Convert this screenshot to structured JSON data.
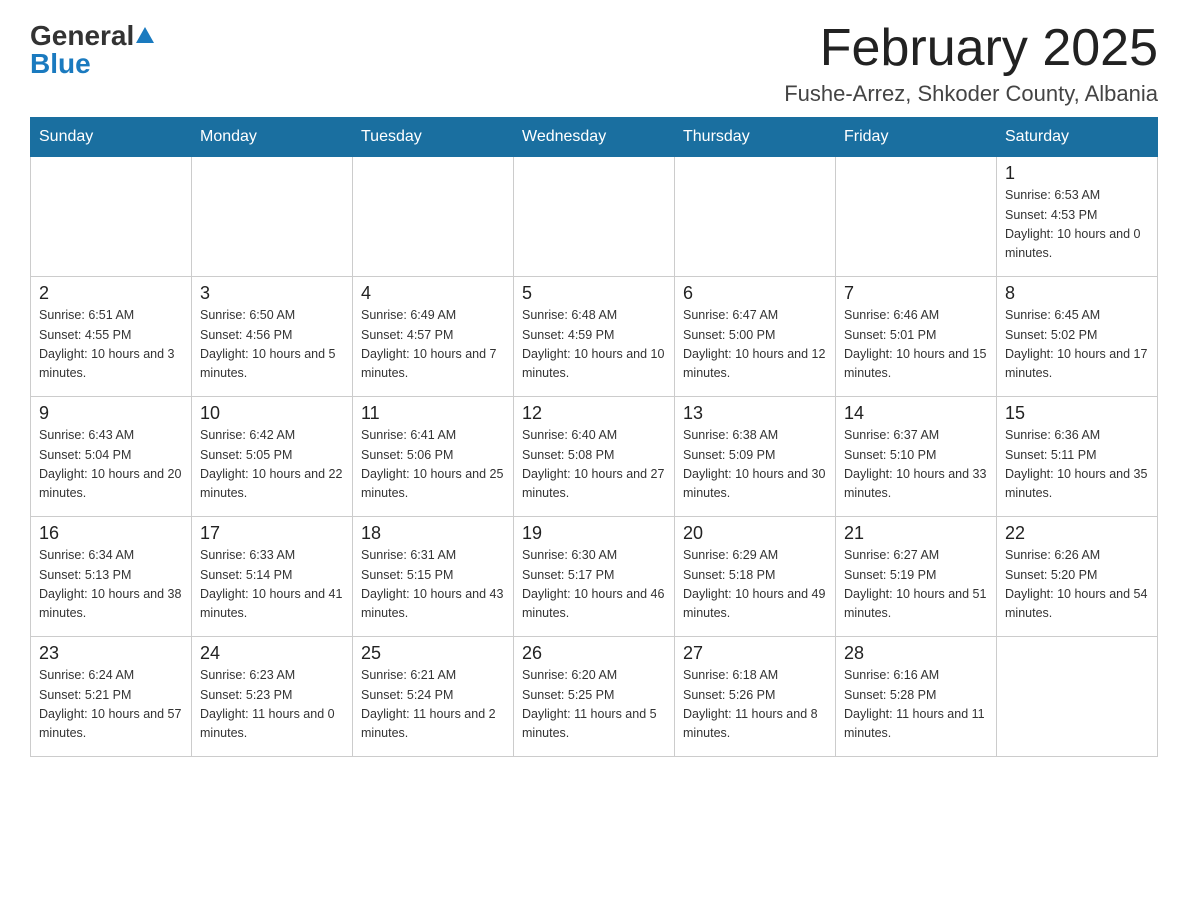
{
  "header": {
    "logo_general": "General",
    "logo_blue": "Blue",
    "month_title": "February 2025",
    "location": "Fushe-Arrez, Shkoder County, Albania"
  },
  "days_of_week": [
    "Sunday",
    "Monday",
    "Tuesday",
    "Wednesday",
    "Thursday",
    "Friday",
    "Saturday"
  ],
  "weeks": [
    [
      {
        "day": "",
        "info": ""
      },
      {
        "day": "",
        "info": ""
      },
      {
        "day": "",
        "info": ""
      },
      {
        "day": "",
        "info": ""
      },
      {
        "day": "",
        "info": ""
      },
      {
        "day": "",
        "info": ""
      },
      {
        "day": "1",
        "info": "Sunrise: 6:53 AM\nSunset: 4:53 PM\nDaylight: 10 hours and 0 minutes."
      }
    ],
    [
      {
        "day": "2",
        "info": "Sunrise: 6:51 AM\nSunset: 4:55 PM\nDaylight: 10 hours and 3 minutes."
      },
      {
        "day": "3",
        "info": "Sunrise: 6:50 AM\nSunset: 4:56 PM\nDaylight: 10 hours and 5 minutes."
      },
      {
        "day": "4",
        "info": "Sunrise: 6:49 AM\nSunset: 4:57 PM\nDaylight: 10 hours and 7 minutes."
      },
      {
        "day": "5",
        "info": "Sunrise: 6:48 AM\nSunset: 4:59 PM\nDaylight: 10 hours and 10 minutes."
      },
      {
        "day": "6",
        "info": "Sunrise: 6:47 AM\nSunset: 5:00 PM\nDaylight: 10 hours and 12 minutes."
      },
      {
        "day": "7",
        "info": "Sunrise: 6:46 AM\nSunset: 5:01 PM\nDaylight: 10 hours and 15 minutes."
      },
      {
        "day": "8",
        "info": "Sunrise: 6:45 AM\nSunset: 5:02 PM\nDaylight: 10 hours and 17 minutes."
      }
    ],
    [
      {
        "day": "9",
        "info": "Sunrise: 6:43 AM\nSunset: 5:04 PM\nDaylight: 10 hours and 20 minutes."
      },
      {
        "day": "10",
        "info": "Sunrise: 6:42 AM\nSunset: 5:05 PM\nDaylight: 10 hours and 22 minutes."
      },
      {
        "day": "11",
        "info": "Sunrise: 6:41 AM\nSunset: 5:06 PM\nDaylight: 10 hours and 25 minutes."
      },
      {
        "day": "12",
        "info": "Sunrise: 6:40 AM\nSunset: 5:08 PM\nDaylight: 10 hours and 27 minutes."
      },
      {
        "day": "13",
        "info": "Sunrise: 6:38 AM\nSunset: 5:09 PM\nDaylight: 10 hours and 30 minutes."
      },
      {
        "day": "14",
        "info": "Sunrise: 6:37 AM\nSunset: 5:10 PM\nDaylight: 10 hours and 33 minutes."
      },
      {
        "day": "15",
        "info": "Sunrise: 6:36 AM\nSunset: 5:11 PM\nDaylight: 10 hours and 35 minutes."
      }
    ],
    [
      {
        "day": "16",
        "info": "Sunrise: 6:34 AM\nSunset: 5:13 PM\nDaylight: 10 hours and 38 minutes."
      },
      {
        "day": "17",
        "info": "Sunrise: 6:33 AM\nSunset: 5:14 PM\nDaylight: 10 hours and 41 minutes."
      },
      {
        "day": "18",
        "info": "Sunrise: 6:31 AM\nSunset: 5:15 PM\nDaylight: 10 hours and 43 minutes."
      },
      {
        "day": "19",
        "info": "Sunrise: 6:30 AM\nSunset: 5:17 PM\nDaylight: 10 hours and 46 minutes."
      },
      {
        "day": "20",
        "info": "Sunrise: 6:29 AM\nSunset: 5:18 PM\nDaylight: 10 hours and 49 minutes."
      },
      {
        "day": "21",
        "info": "Sunrise: 6:27 AM\nSunset: 5:19 PM\nDaylight: 10 hours and 51 minutes."
      },
      {
        "day": "22",
        "info": "Sunrise: 6:26 AM\nSunset: 5:20 PM\nDaylight: 10 hours and 54 minutes."
      }
    ],
    [
      {
        "day": "23",
        "info": "Sunrise: 6:24 AM\nSunset: 5:21 PM\nDaylight: 10 hours and 57 minutes."
      },
      {
        "day": "24",
        "info": "Sunrise: 6:23 AM\nSunset: 5:23 PM\nDaylight: 11 hours and 0 minutes."
      },
      {
        "day": "25",
        "info": "Sunrise: 6:21 AM\nSunset: 5:24 PM\nDaylight: 11 hours and 2 minutes."
      },
      {
        "day": "26",
        "info": "Sunrise: 6:20 AM\nSunset: 5:25 PM\nDaylight: 11 hours and 5 minutes."
      },
      {
        "day": "27",
        "info": "Sunrise: 6:18 AM\nSunset: 5:26 PM\nDaylight: 11 hours and 8 minutes."
      },
      {
        "day": "28",
        "info": "Sunrise: 6:16 AM\nSunset: 5:28 PM\nDaylight: 11 hours and 11 minutes."
      },
      {
        "day": "",
        "info": ""
      }
    ]
  ]
}
